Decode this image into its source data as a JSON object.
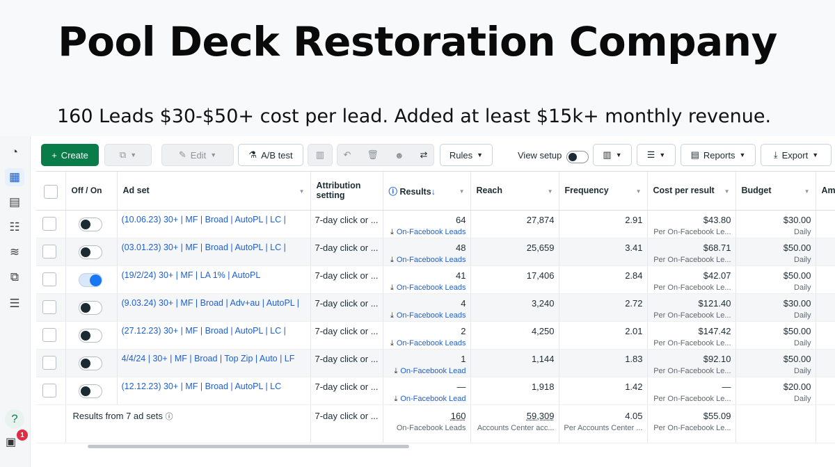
{
  "headline": "Pool Deck Restoration Company",
  "subline": "160 Leads $30-$50+ cost per lead.  Added at least $15k+ monthly revenue.",
  "rail": {
    "notification_count": "1",
    "help": "?"
  },
  "toolbar": {
    "create": "Create",
    "edit": "Edit",
    "ab_test": "A/B test",
    "rules": "Rules",
    "view_setup": "View setup",
    "reports": "Reports",
    "export": "Export"
  },
  "columns": {
    "off_on": "Off / On",
    "ad_set": "Ad set",
    "attribution": "Attribution setting",
    "results": "Results",
    "reach": "Reach",
    "frequency": "Frequency",
    "cost_per_result": "Cost per result",
    "budget": "Budget",
    "amount": "Am"
  },
  "rows": [
    {
      "name": "(10.06.23) 30+ | MF | Broad | AutoPL | LC |",
      "on": false,
      "attribution": "7-day click or ...",
      "results": "64",
      "result_type": "On-Facebook Leads",
      "reach": "27,874",
      "frequency": "2.91",
      "cost": "$43.80",
      "cost_sub": "Per On-Facebook Le...",
      "budget": "$30.00",
      "budget_sub": "Daily"
    },
    {
      "name": "(03.01.23) 30+ | MF | Broad | AutoPL | LC |",
      "on": false,
      "attribution": "7-day click or ...",
      "results": "48",
      "result_type": "On-Facebook Leads",
      "reach": "25,659",
      "frequency": "3.41",
      "cost": "$68.71",
      "cost_sub": "Per On-Facebook Le...",
      "budget": "$50.00",
      "budget_sub": "Daily"
    },
    {
      "name": "(19/2/24) 30+ | MF | LA 1% | AutoPL",
      "on": true,
      "attribution": "7-day click or ...",
      "results": "41",
      "result_type": "On-Facebook Leads",
      "reach": "17,406",
      "frequency": "2.84",
      "cost": "$42.07",
      "cost_sub": "Per On-Facebook Le...",
      "budget": "$50.00",
      "budget_sub": "Daily"
    },
    {
      "name": "(9.03.24) 30+ | MF | Broad | Adv+au | AutoPL |",
      "on": false,
      "attribution": "7-day click or ...",
      "results": "4",
      "result_type": "On-Facebook Leads",
      "reach": "3,240",
      "frequency": "2.72",
      "cost": "$121.40",
      "cost_sub": "Per On-Facebook Le...",
      "budget": "$30.00",
      "budget_sub": "Daily"
    },
    {
      "name": "(27.12.23) 30+ | MF | Broad | AutoPL | LC |",
      "on": false,
      "attribution": "7-day click or ...",
      "results": "2",
      "result_type": "On-Facebook Leads",
      "reach": "4,250",
      "frequency": "2.01",
      "cost": "$147.42",
      "cost_sub": "Per On-Facebook Le...",
      "budget": "$50.00",
      "budget_sub": "Daily"
    },
    {
      "name": "4/4/24 | 30+ | MF | Broad | Top Zip | Auto | LF",
      "on": false,
      "attribution": "7-day click or ...",
      "results": "1",
      "result_type": "On-Facebook Lead",
      "reach": "1,144",
      "frequency": "1.83",
      "cost": "$92.10",
      "cost_sub": "Per On-Facebook Le...",
      "budget": "$50.00",
      "budget_sub": "Daily"
    },
    {
      "name": "(12.12.23) 30+ | MF | Broad | AutoPL | LC",
      "on": false,
      "attribution": "7-day click or ...",
      "results": "—",
      "result_type": "On-Facebook Lead",
      "reach": "1,918",
      "frequency": "1.42",
      "cost": "—",
      "cost_sub": "Per On-Facebook Le...",
      "budget": "$20.00",
      "budget_sub": "Daily"
    }
  ],
  "totals": {
    "label": "Results from 7 ad sets",
    "attribution": "7-day click or ...",
    "results": "160",
    "results_sub": "On-Facebook Leads",
    "reach": "59,309",
    "reach_sub": "Accounts Center acc...",
    "frequency": "4.05",
    "frequency_sub": "Per Accounts Center ...",
    "cost": "$55.09",
    "cost_sub": "Per On-Facebook Le..."
  }
}
